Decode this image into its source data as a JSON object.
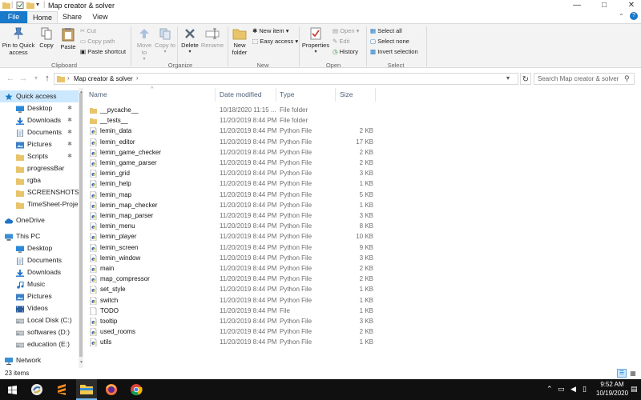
{
  "window": {
    "title": "Map creator  & solver",
    "controls": {
      "minimize": "—",
      "maximize": "□",
      "close": "✕"
    }
  },
  "ribbon_tabs": [
    {
      "label": "File"
    },
    {
      "label": "Home"
    },
    {
      "label": "Share"
    },
    {
      "label": "View"
    }
  ],
  "ribbon": {
    "clipboard": {
      "group_label": "Clipboard",
      "pin_label": "Pin to Quick access",
      "copy_label": "Copy",
      "paste_label": "Paste",
      "cut_label": "Cut",
      "copy_path_label": "Copy path",
      "paste_shortcut_label": "Paste shortcut"
    },
    "organize": {
      "group_label": "Organize",
      "move_to_label": "Move to",
      "copy_to_label": "Copy to",
      "delete_label": "Delete",
      "rename_label": "Rename"
    },
    "new": {
      "group_label": "New",
      "new_folder_label": "New folder",
      "new_item_label": "New item",
      "easy_access_label": "Easy access"
    },
    "open": {
      "group_label": "Open",
      "properties_label": "Properties",
      "open_label": "Open",
      "edit_label": "Edit",
      "history_label": "History"
    },
    "select": {
      "group_label": "Select",
      "select_all_label": "Select all",
      "select_none_label": "Select none",
      "invert_selection_label": "Invert selection"
    }
  },
  "address_bar": {
    "path": "Map creator  & solver",
    "search_placeholder": "Search Map creator  & solver"
  },
  "nav_pane": {
    "items": [
      {
        "label": "Quick access",
        "icon": "star-icon",
        "pinned": false,
        "indent": 0,
        "selected": true
      },
      {
        "label": "Desktop",
        "icon": "desktop-icon",
        "pinned": true,
        "indent": 1
      },
      {
        "label": "Downloads",
        "icon": "download-icon",
        "pinned": true,
        "indent": 1
      },
      {
        "label": "Documents",
        "icon": "documents-icon",
        "pinned": true,
        "indent": 1
      },
      {
        "label": "Pictures",
        "icon": "pictures-icon",
        "pinned": true,
        "indent": 1
      },
      {
        "label": "Scripts",
        "icon": "folder-icon",
        "pinned": true,
        "indent": 1
      },
      {
        "label": "progressBar",
        "icon": "folder-icon",
        "pinned": false,
        "indent": 1
      },
      {
        "label": "rgba",
        "icon": "folder-icon",
        "pinned": false,
        "indent": 1
      },
      {
        "label": "SCREENSHOTS",
        "icon": "folder-icon",
        "pinned": false,
        "indent": 1
      },
      {
        "label": "TimeSheet-Proje",
        "icon": "folder-icon",
        "pinned": false,
        "indent": 1
      },
      {
        "label": "",
        "icon": "",
        "spacer": true
      },
      {
        "label": "OneDrive",
        "icon": "cloud-icon",
        "pinned": false,
        "indent": 0
      },
      {
        "label": "",
        "icon": "",
        "spacer": true
      },
      {
        "label": "This PC",
        "icon": "computer-icon",
        "pinned": false,
        "indent": 0
      },
      {
        "label": "Desktop",
        "icon": "desktop-icon",
        "pinned": false,
        "indent": 1
      },
      {
        "label": "Documents",
        "icon": "documents-icon",
        "pinned": false,
        "indent": 1
      },
      {
        "label": "Downloads",
        "icon": "download-icon",
        "pinned": false,
        "indent": 1
      },
      {
        "label": "Music",
        "icon": "music-icon",
        "pinned": false,
        "indent": 1
      },
      {
        "label": "Pictures",
        "icon": "pictures-icon",
        "pinned": false,
        "indent": 1
      },
      {
        "label": "Videos",
        "icon": "videos-icon",
        "pinned": false,
        "indent": 1
      },
      {
        "label": "Local Disk (C:)",
        "icon": "drive-icon",
        "pinned": false,
        "indent": 1
      },
      {
        "label": "softwares (D:)",
        "icon": "drive-icon",
        "pinned": false,
        "indent": 1
      },
      {
        "label": "education (E:)",
        "icon": "drive-icon",
        "pinned": false,
        "indent": 1
      },
      {
        "label": "",
        "icon": "",
        "spacer": true
      },
      {
        "label": "Network",
        "icon": "network-icon",
        "pinned": false,
        "indent": 0
      }
    ]
  },
  "file_list": {
    "columns": {
      "name": "Name",
      "date": "Date modified",
      "type": "Type",
      "size": "Size"
    },
    "rows": [
      {
        "name": "__pycache__",
        "date": "10/18/2020 11:15 ...",
        "type": "File folder",
        "size": "",
        "icon": "folder-icon"
      },
      {
        "name": "__tests__",
        "date": "11/20/2019 8:44 PM",
        "type": "File folder",
        "size": "",
        "icon": "folder-icon"
      },
      {
        "name": "lemin_data",
        "date": "11/20/2019 8:44 PM",
        "type": "Python File",
        "size": "2 KB",
        "icon": "python-file-icon"
      },
      {
        "name": "lemin_editor",
        "date": "11/20/2019 8:44 PM",
        "type": "Python File",
        "size": "17 KB",
        "icon": "python-file-icon"
      },
      {
        "name": "lemin_game_checker",
        "date": "11/20/2019 8:44 PM",
        "type": "Python File",
        "size": "2 KB",
        "icon": "python-file-icon"
      },
      {
        "name": "lemin_game_parser",
        "date": "11/20/2019 8:44 PM",
        "type": "Python File",
        "size": "2 KB",
        "icon": "python-file-icon"
      },
      {
        "name": "lemin_grid",
        "date": "11/20/2019 8:44 PM",
        "type": "Python File",
        "size": "3 KB",
        "icon": "python-file-icon"
      },
      {
        "name": "lemin_help",
        "date": "11/20/2019 8:44 PM",
        "type": "Python File",
        "size": "1 KB",
        "icon": "python-file-icon"
      },
      {
        "name": "lemin_map",
        "date": "11/20/2019 8:44 PM",
        "type": "Python File",
        "size": "5 KB",
        "icon": "python-file-icon"
      },
      {
        "name": "lemin_map_checker",
        "date": "11/20/2019 8:44 PM",
        "type": "Python File",
        "size": "1 KB",
        "icon": "python-file-icon"
      },
      {
        "name": "lemin_map_parser",
        "date": "11/20/2019 8:44 PM",
        "type": "Python File",
        "size": "3 KB",
        "icon": "python-file-icon"
      },
      {
        "name": "lemin_menu",
        "date": "11/20/2019 8:44 PM",
        "type": "Python File",
        "size": "8 KB",
        "icon": "python-file-icon"
      },
      {
        "name": "lemin_player",
        "date": "11/20/2019 8:44 PM",
        "type": "Python File",
        "size": "10 KB",
        "icon": "python-file-icon"
      },
      {
        "name": "lemin_screen",
        "date": "11/20/2019 8:44 PM",
        "type": "Python File",
        "size": "9 KB",
        "icon": "python-file-icon"
      },
      {
        "name": "lemin_window",
        "date": "11/20/2019 8:44 PM",
        "type": "Python File",
        "size": "3 KB",
        "icon": "python-file-icon"
      },
      {
        "name": "main",
        "date": "11/20/2019 8:44 PM",
        "type": "Python File",
        "size": "2 KB",
        "icon": "python-file-icon"
      },
      {
        "name": "map_compressor",
        "date": "11/20/2019 8:44 PM",
        "type": "Python File",
        "size": "2 KB",
        "icon": "python-file-icon"
      },
      {
        "name": "set_style",
        "date": "11/20/2019 8:44 PM",
        "type": "Python File",
        "size": "1 KB",
        "icon": "python-file-icon"
      },
      {
        "name": "switch",
        "date": "11/20/2019 8:44 PM",
        "type": "Python File",
        "size": "1 KB",
        "icon": "python-file-icon"
      },
      {
        "name": "TODO",
        "date": "11/20/2019 8:44 PM",
        "type": "File",
        "size": "1 KB",
        "icon": "file-icon"
      },
      {
        "name": "tooltip",
        "date": "11/20/2019 8:44 PM",
        "type": "Python File",
        "size": "3 KB",
        "icon": "python-file-icon"
      },
      {
        "name": "used_rooms",
        "date": "11/20/2019 8:44 PM",
        "type": "Python File",
        "size": "2 KB",
        "icon": "python-file-icon"
      },
      {
        "name": "utils",
        "date": "11/20/2019 8:44 PM",
        "type": "Python File",
        "size": "1 KB",
        "icon": "python-file-icon"
      }
    ]
  },
  "status_bar": {
    "item_count": "23 items"
  },
  "taskbar": {
    "time": "9:52 AM",
    "date": "10/19/2020",
    "apps": [
      "start-icon",
      "python-idle-icon",
      "sublime-icon",
      "file-explorer-icon",
      "firefox-icon",
      "chrome-icon"
    ]
  },
  "colors": {
    "accent": "#1979ca",
    "selection": "#cce8ff",
    "folder": "#e8c46a",
    "taskbar": "#101010"
  }
}
